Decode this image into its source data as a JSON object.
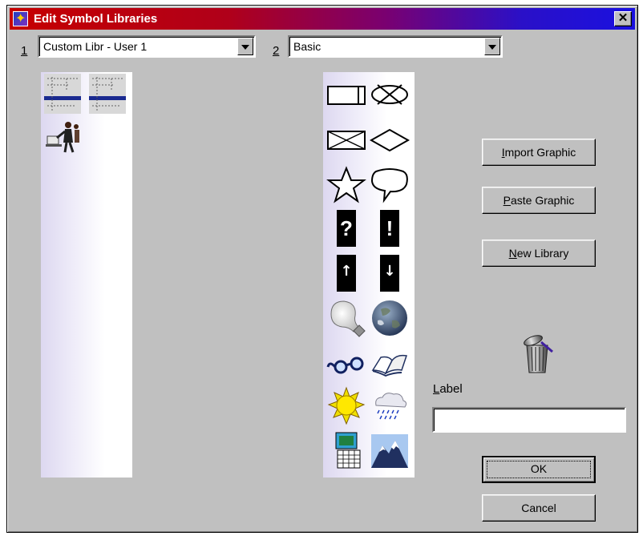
{
  "window": {
    "title": "Edit Symbol Libraries",
    "close_label": "✕"
  },
  "library1": {
    "number": "1",
    "selected": "Custom Libr - User 1",
    "symbols": [
      "custom-symbol-1",
      "custom-symbol-2",
      "person-at-computer"
    ]
  },
  "library2": {
    "number": "2",
    "selected": "Basic",
    "symbols": [
      "rectangle",
      "crossed-ellipse",
      "crossed-rectangle",
      "diamond",
      "star",
      "speech-bubble",
      "question-mark",
      "exclamation-mark",
      "up-arrow",
      "down-arrow",
      "light-bulb",
      "globe",
      "eyeglasses",
      "open-book",
      "sun",
      "rain-cloud",
      "calendar-picture",
      "mountain"
    ],
    "question_glyph": "?",
    "exclamation_glyph": "!",
    "up_glyph": "↑",
    "down_glyph": "↓"
  },
  "buttons": {
    "import_mnemonic": "I",
    "import_rest": "mport Graphic",
    "paste_mnemonic": "P",
    "paste_rest": "aste Graphic",
    "new_mnemonic": "N",
    "new_rest": "ew Library",
    "ok": "OK",
    "cancel": "Cancel"
  },
  "label_field": {
    "mnemonic": "L",
    "rest": "abel",
    "value": ""
  },
  "icons": {
    "trash": "trash-can-icon"
  }
}
